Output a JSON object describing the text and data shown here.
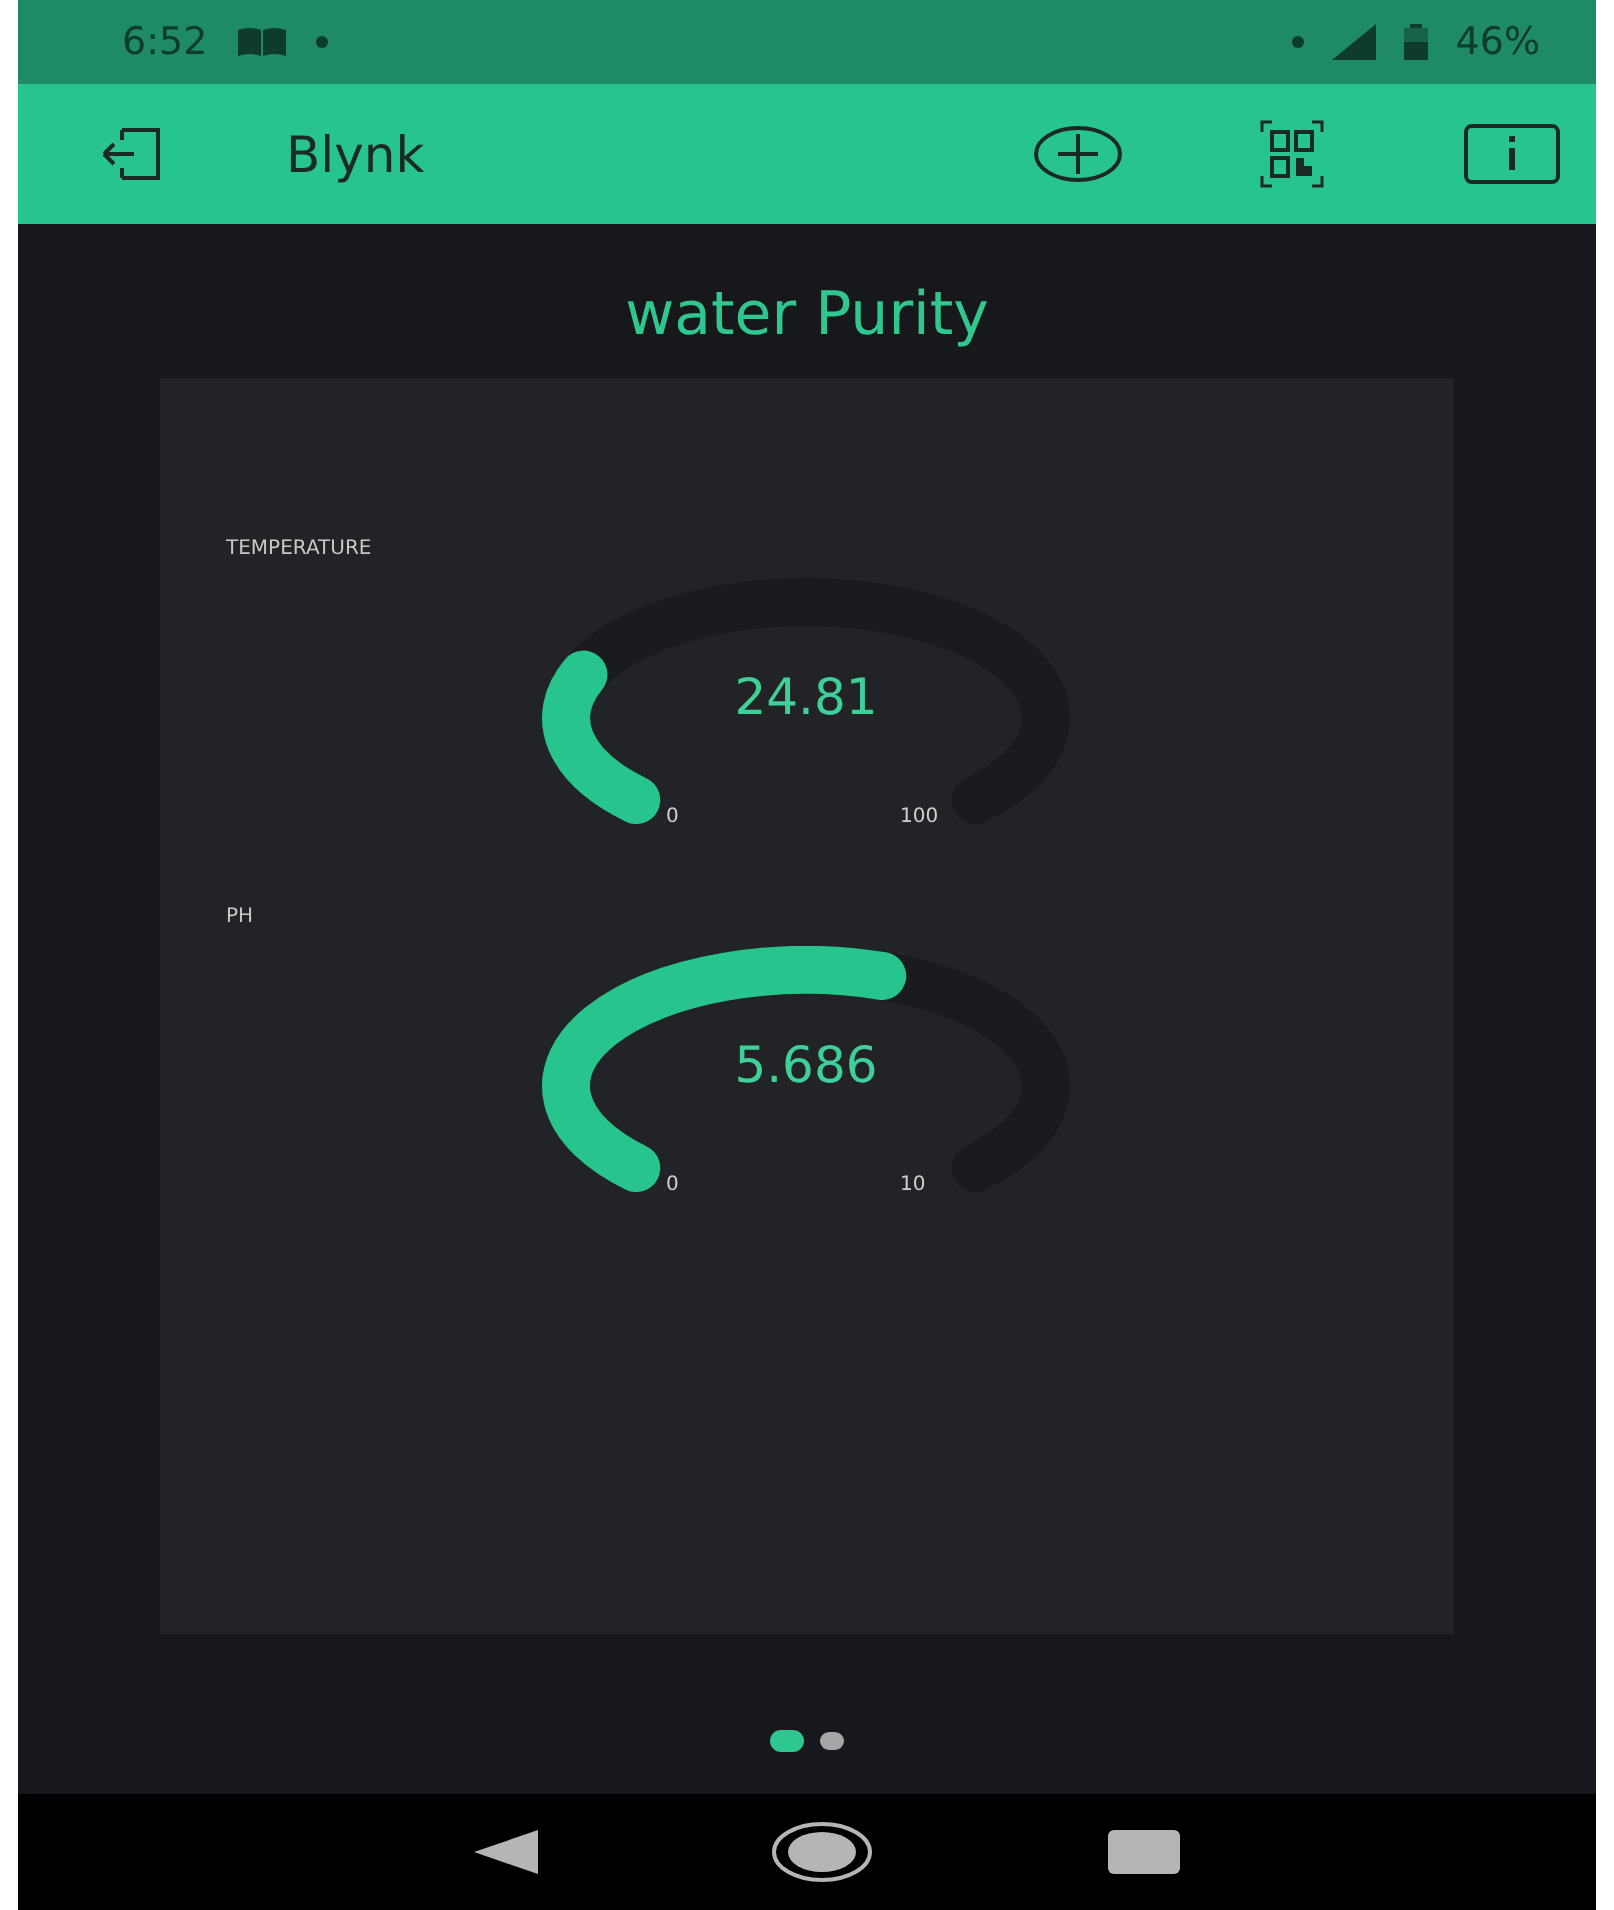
{
  "status_bar": {
    "time": "6:52",
    "battery": "46%"
  },
  "app_bar": {
    "title": "Blynk"
  },
  "project": {
    "title": "water Purity"
  },
  "gauges": [
    {
      "label": "TEMPERATURE",
      "value": "24.81",
      "min": "0",
      "max": "100"
    },
    {
      "label": "PH",
      "value": "5.686",
      "min": "0",
      "max": "10"
    }
  ],
  "pages": [
    {
      "selected": true
    },
    {
      "selected": false
    }
  ]
}
